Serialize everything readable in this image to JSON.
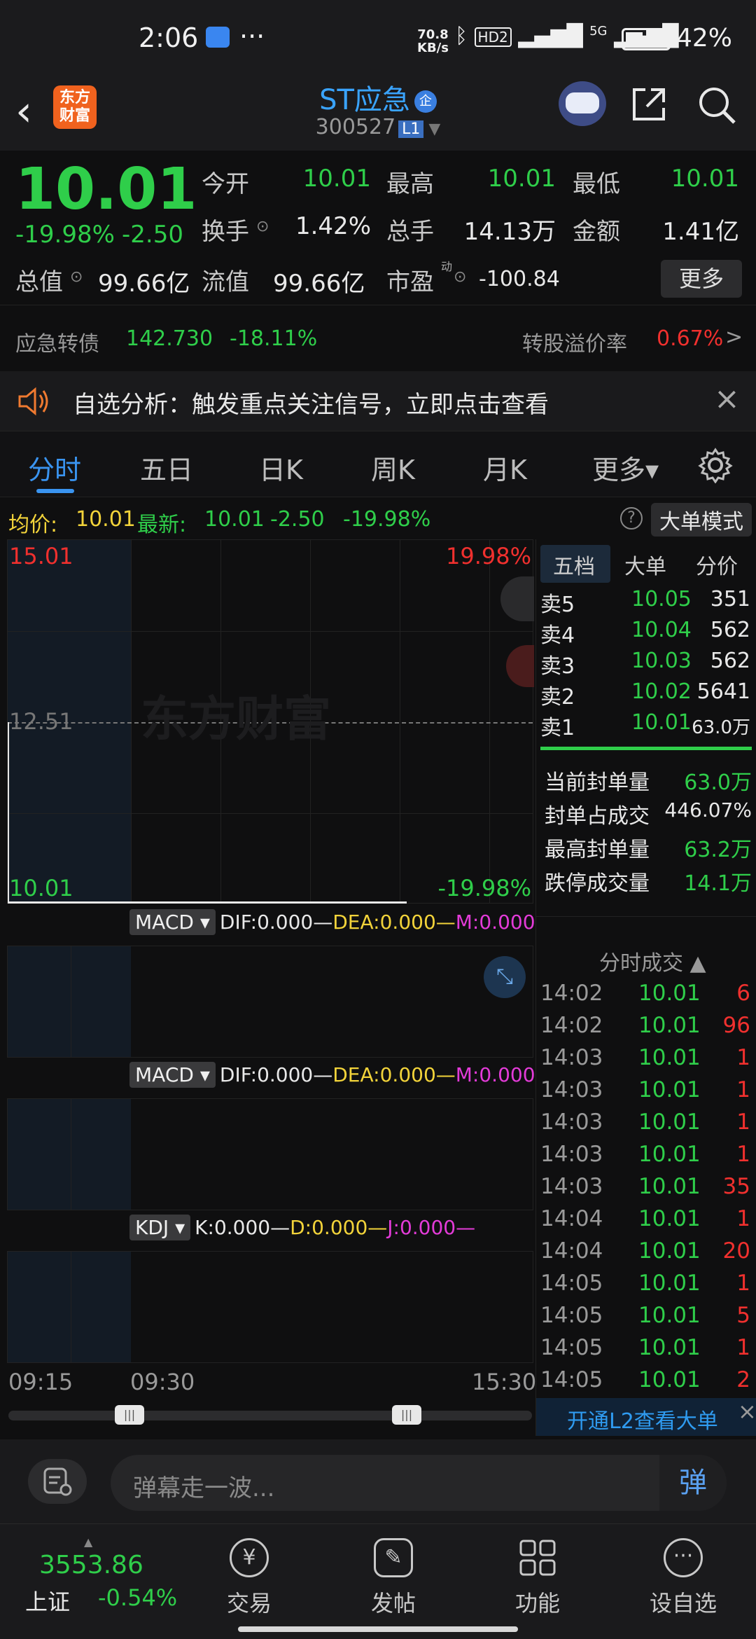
{
  "status_bar": {
    "time": "2:06",
    "more": "···",
    "net_speed_value": "70.8",
    "net_speed_unit": "KB/s",
    "hd": "HD2",
    "signal": "5G",
    "battery": "42%"
  },
  "header": {
    "app_logo_line1": "东方",
    "app_logo_line2": "财富",
    "stock_name": "ST应急",
    "badge": "企",
    "stock_code": "300527",
    "level": "L1"
  },
  "quote": {
    "price": "10.01",
    "change_pct": "-19.98%",
    "change_val": "-2.50",
    "open_label": "今开",
    "open": "10.01",
    "high_label": "最高",
    "high": "10.01",
    "low_label": "最低",
    "low": "10.01",
    "turnover_label": "换手",
    "turnover": "1.42%",
    "volume_label": "总手",
    "volume": "14.13万",
    "amount_label": "金额",
    "amount": "1.41亿",
    "mktcap_label": "总值",
    "mktcap": "99.66亿",
    "float_label": "流值",
    "float": "99.66亿",
    "pe_label": "市盈",
    "pe_sup": "动",
    "pe": "-100.84",
    "more_button": "更多"
  },
  "convertible": {
    "name": "应急转债",
    "price": "142.730",
    "change": "-18.11%",
    "premium_label": "转股溢价率",
    "premium": "0.67%",
    "arrow": ">"
  },
  "banner": {
    "text": "自选分析：触发重点关注信号，立即点击查看"
  },
  "tabs": [
    "分时",
    "五日",
    "日K",
    "周K",
    "月K",
    "更多▾"
  ],
  "avg_line": {
    "avg_label": "均价:",
    "avg": "10.01",
    "latest_label": "最新:",
    "latest": "10.01",
    "chg": "-2.50",
    "pct": "-19.98%",
    "big_order_mode": "大单模式"
  },
  "chart": {
    "watermark": "东方财富",
    "y_top": "15.01",
    "y_mid": "12.51",
    "y_bottom": "10.01",
    "pct_top": "19.98%",
    "pct_bottom": "-19.98%",
    "x_start": "09:15",
    "x_mid": "09:30",
    "x_end": "15:30"
  },
  "indicators": [
    {
      "name": "MACD",
      "a": "DIF:0.000",
      "b": "DEA:0.000",
      "c": "M:0.000"
    },
    {
      "name": "MACD",
      "a": "DIF:0.000",
      "b": "DEA:0.000",
      "c": "M:0.000"
    },
    {
      "name": "KDJ",
      "a": "K:0.000",
      "b": "D:0.000",
      "c": "J:0.000"
    }
  ],
  "side_tabs": [
    "五档",
    "大单",
    "分价"
  ],
  "order_book": [
    {
      "label": "卖5",
      "price": "10.05",
      "vol": "351"
    },
    {
      "label": "卖4",
      "price": "10.04",
      "vol": "562"
    },
    {
      "label": "卖3",
      "price": "10.03",
      "vol": "562"
    },
    {
      "label": "卖2",
      "price": "10.02",
      "vol": "5641"
    },
    {
      "label": "卖1",
      "price": "10.01",
      "vol": "63.0万"
    }
  ],
  "seal_stats": [
    {
      "label": "当前封单量",
      "value": "63.0万"
    },
    {
      "label": "封单占成交",
      "value": "446.07%"
    },
    {
      "label": "最高封单量",
      "value": "63.2万"
    },
    {
      "label": "跌停成交量",
      "value": "14.1万"
    }
  ],
  "trades_title": "分时成交",
  "trades": [
    {
      "time": "14:02",
      "price": "10.01",
      "vol": "6"
    },
    {
      "time": "14:02",
      "price": "10.01",
      "vol": "96"
    },
    {
      "time": "14:03",
      "price": "10.01",
      "vol": "1"
    },
    {
      "time": "14:03",
      "price": "10.01",
      "vol": "1"
    },
    {
      "time": "14:03",
      "price": "10.01",
      "vol": "1"
    },
    {
      "time": "14:03",
      "price": "10.01",
      "vol": "1"
    },
    {
      "time": "14:03",
      "price": "10.01",
      "vol": "35"
    },
    {
      "time": "14:04",
      "price": "10.01",
      "vol": "1"
    },
    {
      "time": "14:04",
      "price": "10.01",
      "vol": "20"
    },
    {
      "time": "14:05",
      "price": "10.01",
      "vol": "1"
    },
    {
      "time": "14:05",
      "price": "10.01",
      "vol": "5"
    },
    {
      "time": "14:05",
      "price": "10.01",
      "vol": "1"
    },
    {
      "time": "14:05",
      "price": "10.01",
      "vol": "2"
    }
  ],
  "l2_banner": "开通L2查看大单",
  "comment": {
    "placeholder": "弹幕走一波...",
    "send_label": "弹"
  },
  "bottom_nav": {
    "index_value": "3553.86",
    "index_name": "上证",
    "index_change": "-0.54%",
    "items": [
      "交易",
      "发帖",
      "功能",
      "设自选"
    ]
  }
}
